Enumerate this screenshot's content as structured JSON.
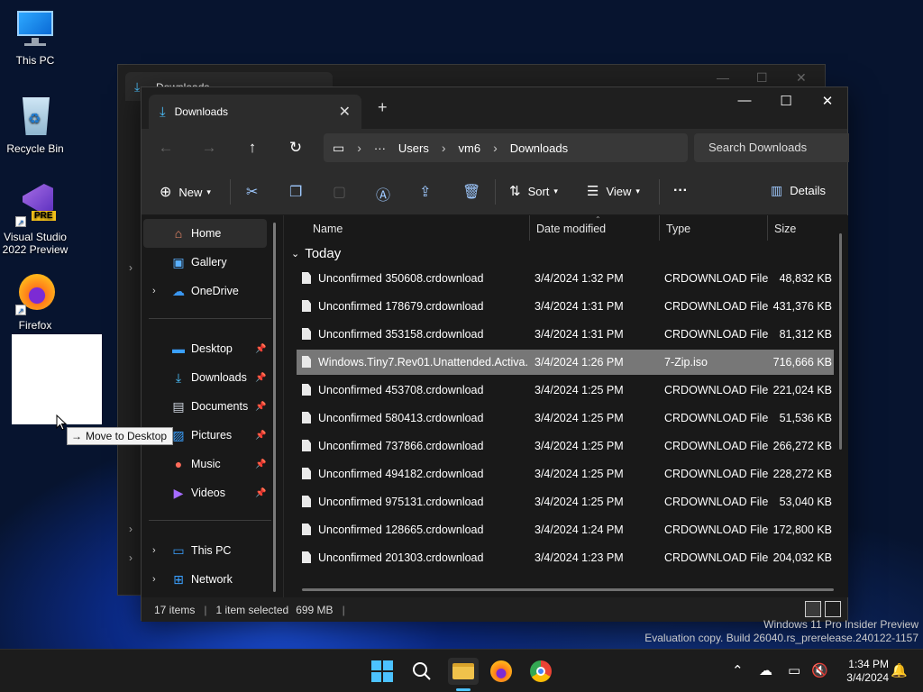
{
  "desktop": {
    "icons": [
      {
        "label": "This PC"
      },
      {
        "label": "Recycle Bin"
      },
      {
        "label": "Visual Studio 2022 Preview",
        "badge": "PRE"
      },
      {
        "label": "Firefox"
      }
    ],
    "drag_tooltip": "Move to Desktop",
    "watermark": {
      "line1": "Windows 11 Pro Insider Preview",
      "line2": "Evaluation copy. Build 26040.rs_prerelease.240122-1157"
    }
  },
  "back_window": {
    "tab_title": "Downloads"
  },
  "window": {
    "tab_title": "Downloads",
    "address": {
      "root": "Users",
      "folder1": "vm6",
      "folder2": "Downloads"
    },
    "search_placeholder": "Search Downloads",
    "commands": {
      "new": "New",
      "sort": "Sort",
      "view": "View",
      "details": "Details",
      "more": "···"
    },
    "sidebar": {
      "top": [
        {
          "label": "Home",
          "icon": "home-icon"
        },
        {
          "label": "Gallery",
          "icon": "gallery-icon"
        },
        {
          "label": "OneDrive",
          "icon": "cloud-icon"
        }
      ],
      "pinned": [
        {
          "label": "Desktop",
          "icon": "desktop-icon"
        },
        {
          "label": "Downloads",
          "icon": "download-icon"
        },
        {
          "label": "Documents",
          "icon": "documents-icon"
        },
        {
          "label": "Pictures",
          "icon": "pictures-icon"
        },
        {
          "label": "Music",
          "icon": "music-icon"
        },
        {
          "label": "Videos",
          "icon": "videos-icon"
        }
      ],
      "bottom": [
        {
          "label": "This PC",
          "icon": "pc-icon"
        },
        {
          "label": "Network",
          "icon": "network-icon"
        }
      ]
    },
    "columns": {
      "name": "Name",
      "date": "Date modified",
      "type": "Type",
      "size": "Size"
    },
    "group": "Today",
    "files": [
      {
        "name": "Unconfirmed 350608.crdownload",
        "date": "3/4/2024 1:32 PM",
        "type": "CRDOWNLOAD File",
        "size": "48,832 KB"
      },
      {
        "name": "Unconfirmed 178679.crdownload",
        "date": "3/4/2024 1:31 PM",
        "type": "CRDOWNLOAD File",
        "size": "431,376 KB"
      },
      {
        "name": "Unconfirmed 353158.crdownload",
        "date": "3/4/2024 1:31 PM",
        "type": "CRDOWNLOAD File",
        "size": "81,312 KB"
      },
      {
        "name": "Windows.Tiny7.Rev01.Unattended.Activa...",
        "date": "3/4/2024 1:26 PM",
        "type": "7-Zip.iso",
        "size": "716,666 KB",
        "selected": true
      },
      {
        "name": "Unconfirmed 453708.crdownload",
        "date": "3/4/2024 1:25 PM",
        "type": "CRDOWNLOAD File",
        "size": "221,024 KB"
      },
      {
        "name": "Unconfirmed 580413.crdownload",
        "date": "3/4/2024 1:25 PM",
        "type": "CRDOWNLOAD File",
        "size": "51,536 KB"
      },
      {
        "name": "Unconfirmed 737866.crdownload",
        "date": "3/4/2024 1:25 PM",
        "type": "CRDOWNLOAD File",
        "size": "266,272 KB"
      },
      {
        "name": "Unconfirmed 494182.crdownload",
        "date": "3/4/2024 1:25 PM",
        "type": "CRDOWNLOAD File",
        "size": "228,272 KB"
      },
      {
        "name": "Unconfirmed 975131.crdownload",
        "date": "3/4/2024 1:25 PM",
        "type": "CRDOWNLOAD File",
        "size": "53,040 KB"
      },
      {
        "name": "Unconfirmed 128665.crdownload",
        "date": "3/4/2024 1:24 PM",
        "type": "CRDOWNLOAD File",
        "size": "172,800 KB"
      },
      {
        "name": "Unconfirmed 201303.crdownload",
        "date": "3/4/2024 1:23 PM",
        "type": "CRDOWNLOAD File",
        "size": "204,032 KB"
      }
    ],
    "status": {
      "count": "17 items",
      "selected": "1 item selected",
      "size": "699 MB"
    }
  },
  "taskbar": {
    "time": "1:34 PM",
    "date": "3/4/2024"
  },
  "colors": {
    "accent": "#4cc2ff",
    "selection": "#777777",
    "folder": "#f0c24b"
  }
}
